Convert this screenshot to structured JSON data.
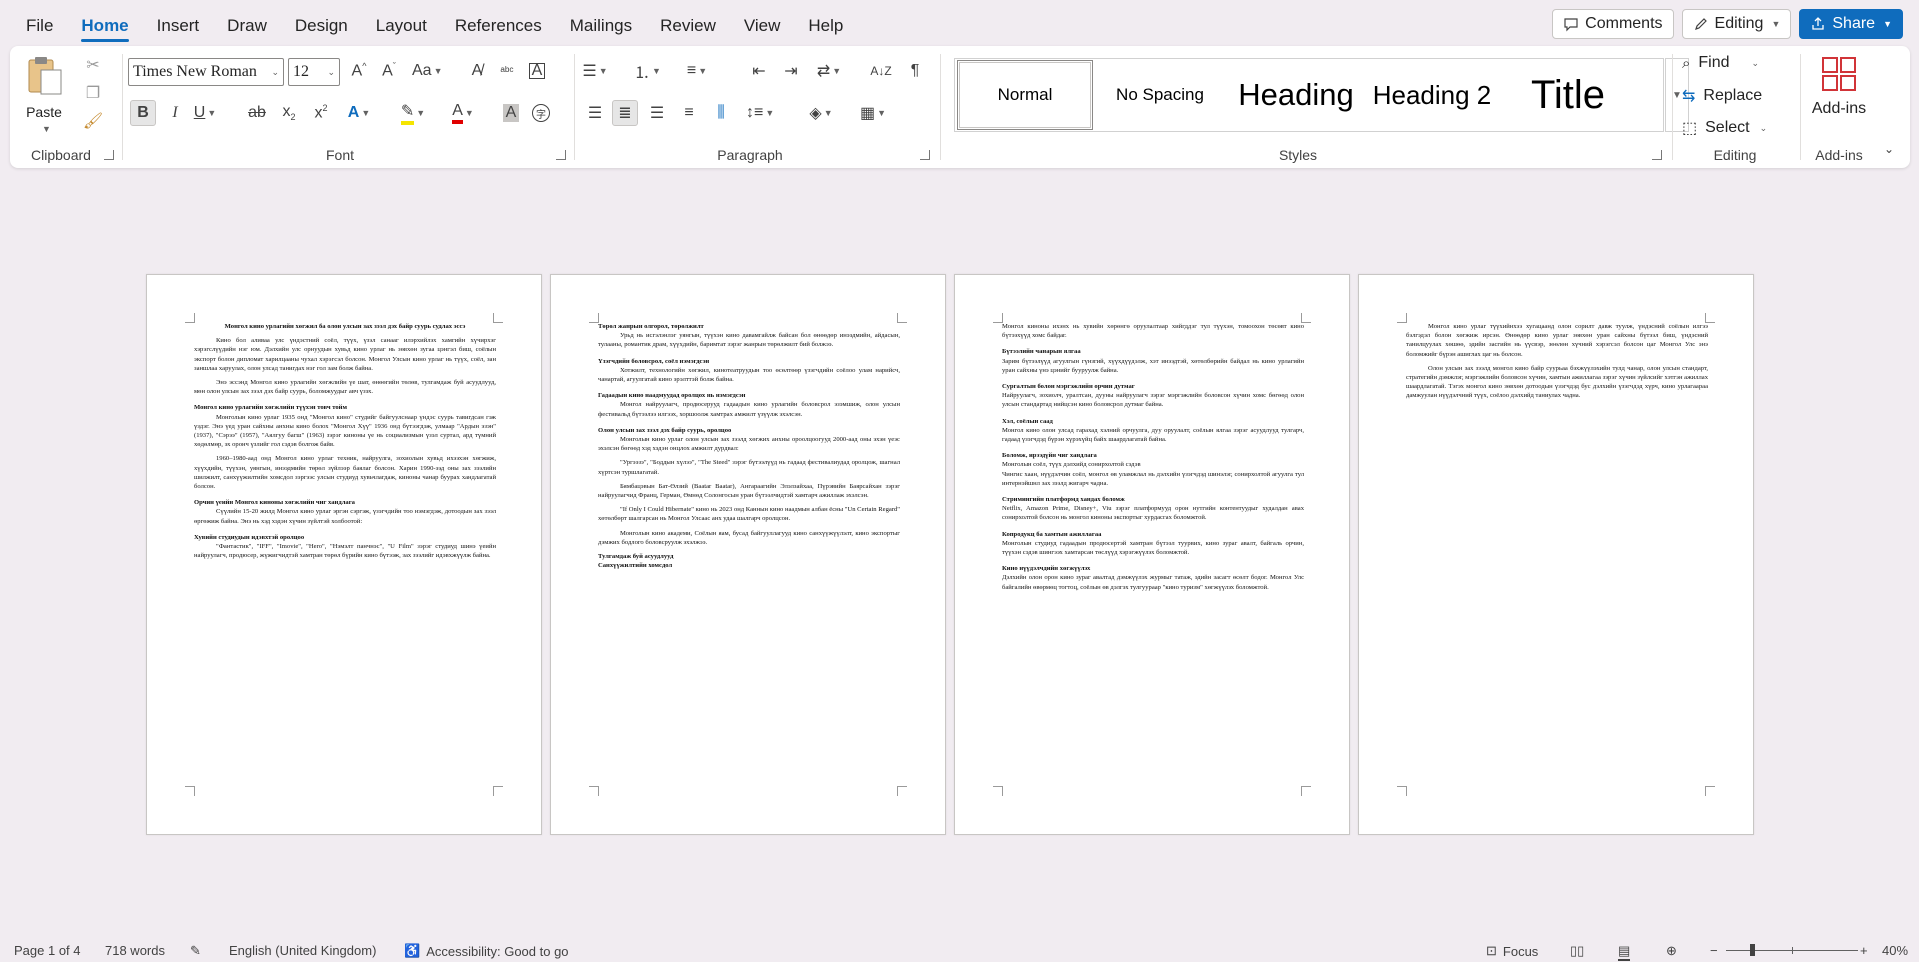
{
  "tabs": [
    "File",
    "Home",
    "Insert",
    "Draw",
    "Design",
    "Layout",
    "References",
    "Mailings",
    "Review",
    "View",
    "Help"
  ],
  "active_tab": "Home",
  "top_right": {
    "comments": "Comments",
    "editing": "Editing",
    "share": "Share"
  },
  "ribbon": {
    "clipboard": {
      "paste": "Paste",
      "label": "Clipboard"
    },
    "font": {
      "family": "Times New Roman",
      "size": "12",
      "label": "Font",
      "change_case": "Aa"
    },
    "paragraph": {
      "label": "Paragraph"
    },
    "styles": {
      "label": "Styles",
      "items": [
        "Normal",
        "No Spacing",
        "Heading",
        "Heading 2",
        "Title"
      ],
      "selected": "Normal"
    },
    "editing": {
      "label": "Editing",
      "find": "Find",
      "replace": "Replace",
      "select": "Select"
    },
    "addins": {
      "label": "Add-ins",
      "button": "Add-ins"
    }
  },
  "pages": [
    {
      "blocks": [
        {
          "t": "title",
          "text": "Монгол кино урлагийн хөгжил ба олон улсын зах зээл дэх байр суурь судлах эссэ"
        },
        {
          "t": "p",
          "text": "Кино бол аливаа улс үндэстний соёл, түүх, үзэл санааг илэрхийлэх хамгийн хүчирхэг хэрэгслүүдийн нэг юм. Дэлхийн улс орнуудын хувьд кино урлаг нь зөвхөн зугаа цэнгэл биш, соёлын экспорт болон дипломат харилцааны чухал хэрэгсэл болсон. Монгол Улсын кино урлаг нь түүх, соёл, зан заншлаа харуулах, олон улсад танигдах нэг гол зам болж байна."
        },
        {
          "t": "p",
          "text": "Энэ эссэнд Монгол кино урлагийн хөгжлийн үе шат, өнөөгийн төлөв, тулгамдаж буй асуудлууд, мөн олон улсын зах зээл дэх байр суурь, боломжуудыг авч үзэх."
        },
        {
          "t": "h",
          "text": "Монгол кино урлагийн хөгжлийн түүхэн товч тойм"
        },
        {
          "t": "p",
          "text": "Монголын кино урлаг 1935 онд \"Монгол кино\" студийг байгуулснаар үндэс суурь тавигдсан гэж үздэг. Энэ үед уран сайхны анхны кино болох \"Монгол Хүү\" 1936 онд бүтээгдэж, улмаар \"Ардын эзэн\" (1937), \"Сэрээ\" (1957), \"Аялгуу багш\" (1963) зэрэг киноны үе нь социализмын үзэл суртал, ард түмний хөдөлмөр, эх оронч үзлийг гол сэдэв болгож байв."
        },
        {
          "t": "p",
          "text": "1960–1980-аад онд Монгол кино урлаг техник, найруулга, зохиолын хувьд ихээхэн хөгжиж, хүүхдийн, түүхэн, уянгын, инээдмийн төрөл зүйлээр баялаг болсон. Харин 1990-ээд оны зах зээлийн шилжилт, санхүүжилтийн хомсдол зэргээс улсын студиуд хувьчлагдаж, киноны чанар буурах хандлагатай болсон."
        },
        {
          "t": "h",
          "text": "Орчин үеийн Монгол киноны хөгжлийн чиг хандлага"
        },
        {
          "t": "p",
          "text": "Сүүлийн 15-20 жилд Монгол кино урлаг эргэн сэргэж, үзэгчдийн тоо нэмэгдэж, дотоодын зах зээл өргөжиж байна. Энэ нь хэд хэдэн хүчин зүйлтэй холбоотой:"
        },
        {
          "t": "h",
          "text": "Хувийн студиудын идэвхтэй оролцоо"
        },
        {
          "t": "p",
          "text": "\"Фантастик\", \"IFF\", \"Imovie\", \"Hero\", \"Нэмэлт панчнэс\", \"U Film\" зэрэг студиуд шинэ үеийн найруулагч, продюсер, жүжигчидтэй хамтран төрөл бүрийн кино бүтээж, зах зээлийг идэвхжүүлж байна."
        }
      ]
    },
    {
      "blocks": [
        {
          "t": "h",
          "text": "Төрөл жанрын олгорол, төрөлжилт"
        },
        {
          "t": "p",
          "text": "Урьд нь исгэлэнлэг уянгын, түүхэн кино давамгайлж байсан бол өнөөдөр инээдмийн, айдасын, тулааны, романтик драм, хүүхдийн, баримтат зэрэг жанрын төрөлжилт бий болжээ."
        },
        {
          "t": "h",
          "text": "Үзэгчдийн боловсрол, соёл нэмэгдсэн"
        },
        {
          "t": "p",
          "text": "Хотжилт, технологийн хөгжил, кинотеатруудын тоо өсөлтөөр үзэгчдийн соёлоо улам нарийсч, чанартай, агуулгатай кино эрэлттэй болж байна."
        },
        {
          "t": "h",
          "text": "Гадаадын кино наадмуудад оролцох нь нэмэгдсэн"
        },
        {
          "t": "p",
          "text": "Монгол найруулагч, продюсерууд гадаадын кино урлагийн боловсрол эзэмшиж, олон улсын фестивальд бүтээлээ илгээх, хоршоолж хамтрах амжилт үзүүлж эхэлсэн."
        },
        {
          "t": "h",
          "text": "Олон улсын зах зээл дэх байр суурь, оролцоо"
        },
        {
          "t": "p",
          "text": "Монголын кино урлаг олон улсын зах зээлд хөгжих анхны ороолцоогууд 2000-аад оны эхэн үеэс эхэлсэн бөгөөд хэд хэдэн онцлох амжилт дурдвал:"
        },
        {
          "t": "p",
          "text": "\"Ургээзэ\", \"Боддын хүлээ\", \"The Steed\" зэрэг бүтээлүүд нь гадаад фестивалиудад оролцож, шагнал хүртсэн туршлагатай."
        },
        {
          "t": "p",
          "text": "Бямбацэвын Бат-Өлзий (Baatar Baatar), Ангараагийн Элэлзайхаа, Пүрэвийн Баярсайхан зэрэг найруулагчид Франц, Герман, Өмнөд Солонгосын уран бүтээлчидтэй хамтарч ажиллаж эхэлсэн."
        },
        {
          "t": "p",
          "text": "\"If Only I Could Hibernate\" кино нь 2023 онд Каннын кино наадмын албан ёсны \"Un Certain Regard\" хөтөлбөрт шалгарсан нь Монгол Улсаас анх удаа шалгарч оролцсон."
        },
        {
          "t": "p",
          "text": "Монголын кино академи, Соёлын яам, бусад байгууллагууд кино санхүүжүүлэлт, кино экспортыг дэмжих бодлого боловсруулж эхэлжээ."
        },
        {
          "t": "hs",
          "text": "Тулгамдаж буй асуудлууд"
        },
        {
          "t": "h0",
          "text": "Санхүүжилтийн хомсдол"
        }
      ]
    },
    {
      "blocks": [
        {
          "t": "pt",
          "text": "Монгол киноны ихэнх нь хувийн хөрөнгө оруулалтаар хийгддэг тул түүхэн, томоохон төсөвт кино бүтээхүүд хомс байдаг."
        },
        {
          "t": "h",
          "text": "Бүтээлийн чанарын ялгаа"
        },
        {
          "t": "pt",
          "text": "Зарим бүтээлүүд агуулгын гүнзгий, хүүхдүүдэлж, хэт инээдтэй, хөтөлбөрийн байдал нь кино урлагийн уран сайхны үнэ цэнийг бууруулж байна."
        },
        {
          "t": "h",
          "text": "Сургалтын болон мэргэжлийн орчин дутмаг"
        },
        {
          "t": "pt",
          "text": "Найруулагч, зохиолч, уралтсан, дууны найруулагч зэрэг мэргэжлийн боловсон хүчин хомс бөгөөд олон улсын стандартад нийцсэн кино боловсрол дутмаг байна."
        },
        {
          "t": "h",
          "text": "Хэл, соёлын саад"
        },
        {
          "t": "pt",
          "text": "Монгол кино олон улсад гарахад хэлний орчуулга, дуу оруулалт, соёлын ялгаа зэрэг асуудлууд тулгарч, гадаад үзэгчдэд бүрэн хүрэхүйц байх шаардлагатай байна."
        },
        {
          "t": "h",
          "text": "Боломж, ирээдүйн чиг хандлага"
        },
        {
          "t": "pt",
          "text": "Монголын соёл, түүх дэлхийд сонирхолтой сэдэв"
        },
        {
          "t": "pt",
          "text": "Чингис хаан, нүүдэлчин соёл, монгол өв уламжлал нь дэлхийн үзэгчдэд шинэлэг, сонирхолтой агуулга тул интернэйшнл зах зээлд жигарч чадна."
        },
        {
          "t": "h",
          "text": "Стримингийн платформд хандах боломж"
        },
        {
          "t": "pt",
          "text": "Netflix, Amazon Prime, Disney+, Viu зэрэг платформууд орон нутгийн контентуудыг худалдан авах сонирхолтой болсон нь монгол киноны экспортыг хурдасгах боломжтой."
        },
        {
          "t": "h",
          "text": "Копродукц ба хамтын ажиллагаа"
        },
        {
          "t": "pt",
          "text": "Монголын студиуд гадаадын продюсертэй хамтран бүтээл туурвих, кино зураг авалт, байгаль орчин, түүхэн сэдэв шингээх хамтарсан төслүүд хэрэгжүүлэх боломжтой."
        },
        {
          "t": "h",
          "text": "Кино нүүдэлчдийн хөгжүүлэх"
        },
        {
          "t": "pt",
          "text": "Дэлхийн олон орон кино зураг авалтад дэмжүүлэх журмыг татаж, эдийн засагт өсөлт бодог. Монгол Улс байгалийн өвөрмөц тогтоц, соёлын өв дэлгэх тулгуураар \"кино туризм\" хөгжүүлэх боломжтой."
        }
      ]
    },
    {
      "blocks": [
        {
          "t": "p",
          "text": "Монгол кино урлаг түүхийнхээ хугацаанд олон сорилт давж туулж, үндэсний соёлын илгээ бэлгэдэл болон хөгжиж ирсэн. Өнөөдөр кино урлаг зөвхөн уран сайхны бүтээл биш, үндэсний танилцуулах хөшөө, эдийн засгийн нь үүсвэр, зөөлөн хүчний хэрэгсэл болсон цаг Монгол Улс энэ боломжийг бүрэн ашиглах цаг нь болсон."
        },
        {
          "t": "p",
          "text": "Олон улсын зах зээлд монгол кино байр суурьаа бэхжүүлэхийн тулд чанар, олон улсын стандарт, стратегийн дэмжлэг, мэргэжлийн боловсон хүчин, хамтын ажиллагаа зэрэг хүчин зүйлсийг хэтгэн ажиллах шаардлагатай. Тэгэх монгол кино зөвхөн дотоодын үзэгчдэд бус дэлхийн үзэгчдэд хүрч, кино урлагаараа дамжуулан нүүдэлчний түүх, соёлоо дэлхийд таниулах чадна."
        }
      ]
    }
  ],
  "status": {
    "page": "Page 1 of 4",
    "words": "718 words",
    "language": "English (United Kingdom)",
    "accessibility": "Accessibility: Good to go",
    "focus": "Focus",
    "zoom": "40%"
  }
}
